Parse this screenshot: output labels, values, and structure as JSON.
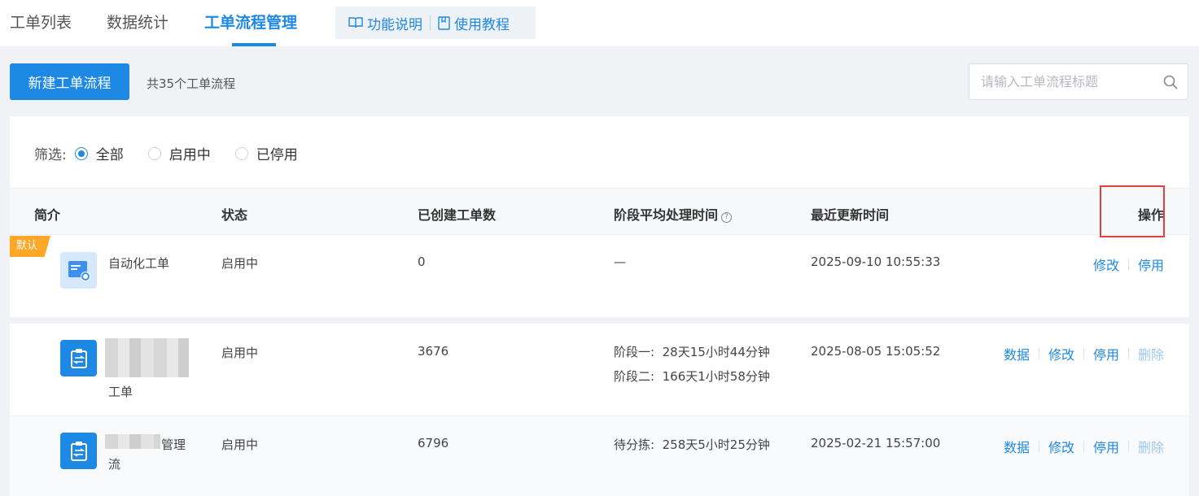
{
  "tabs": [
    {
      "label": "工单列表"
    },
    {
      "label": "数据统计"
    },
    {
      "label": "工单流程管理"
    }
  ],
  "help": {
    "feature_desc": "功能说明",
    "tutorial": "使用教程"
  },
  "toolbar": {
    "new_button": "新建工单流程",
    "total_text": "共35个工单流程",
    "search_placeholder": "请输入工单流程标题"
  },
  "filter": {
    "label": "筛选:",
    "options": [
      "全部",
      "启用中",
      "已停用"
    ],
    "selected": "全部"
  },
  "table": {
    "headers": {
      "intro": "简介",
      "status": "状态",
      "created": "已创建工单数",
      "avg_time": "阶段平均处理时间",
      "updated": "最近更新时间",
      "ops": "操作"
    },
    "rows": [
      {
        "badge": "默认",
        "name": "自动化工单",
        "status": "启用中",
        "created": "0",
        "avg_time": "—",
        "updated": "2025-09-10 10:55:33",
        "ops": [
          "修改",
          "停用"
        ]
      },
      {
        "name_suffix": "工单",
        "status": "启用中",
        "created": "3676",
        "stages": [
          {
            "label": "阶段一:",
            "value": "28天15小时44分钟"
          },
          {
            "label": "阶段二:",
            "value": "166天1小时58分钟"
          }
        ],
        "updated": "2025-08-05 15:05:52",
        "ops": [
          "数据",
          "修改",
          "停用",
          "删除"
        ]
      },
      {
        "name_suffix": "管理",
        "name_line2": "流",
        "status": "启用中",
        "created": "6796",
        "stages": [
          {
            "label": "待分拣:",
            "value": "258天5小时25分钟"
          }
        ],
        "updated": "2025-02-21 15:57:00",
        "ops": [
          "数据",
          "修改",
          "停用",
          "删除"
        ]
      }
    ]
  },
  "colors": {
    "accent": "#1e88e5",
    "badge": "#ffa726",
    "highlight": "#e0413a"
  }
}
